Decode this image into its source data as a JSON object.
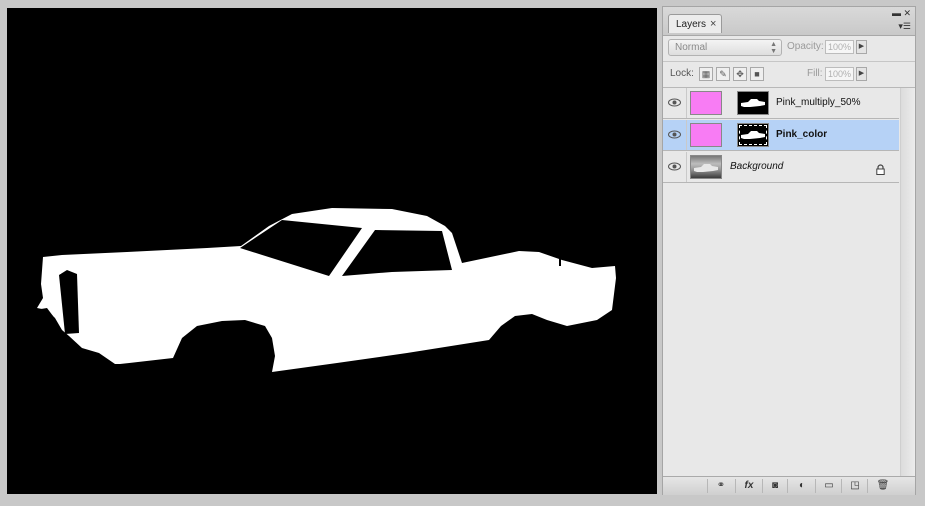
{
  "layers_panel": {
    "tab_label": "Layers",
    "blend_mode": "Normal",
    "opacity_label": "Opacity:",
    "opacity_value": "100%",
    "lock_label": "Lock:",
    "fill_label": "Fill:",
    "fill_value": "100%",
    "layers": [
      {
        "name": "Pink_multiply_50%",
        "visible": true,
        "selected": false,
        "thumb_color": "#f87cf4",
        "has_mask": true
      },
      {
        "name": "Pink_color",
        "visible": true,
        "selected": true,
        "thumb_color": "#f87cf4",
        "has_mask": true
      },
      {
        "name": "Background",
        "visible": true,
        "selected": false,
        "locked": true
      }
    ],
    "bottom_icons": [
      "link-icon",
      "fx-icon",
      "mask-icon",
      "adjustment-icon",
      "folder-icon",
      "new-layer-icon",
      "trash-icon"
    ]
  },
  "colors": {
    "selection": "#b6d2f6",
    "pink": "#f87cf4",
    "canvas": "#000000"
  }
}
